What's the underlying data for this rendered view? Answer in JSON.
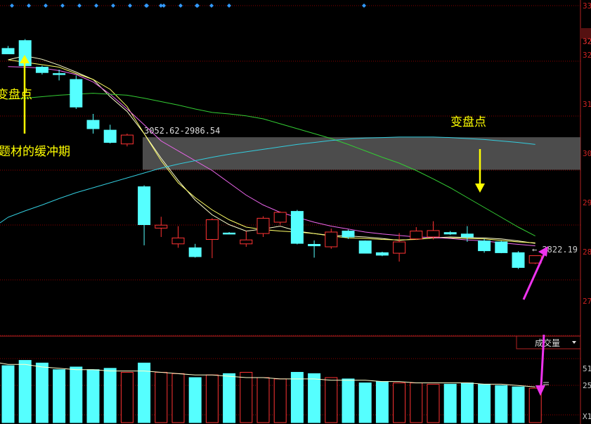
{
  "chart_data": {
    "type": "candlestick",
    "price_axis": {
      "range": [
        2660,
        3320
      ],
      "tick_labels": [
        "33",
        "32",
        "32",
        "31",
        "30",
        "29",
        "28",
        "27"
      ],
      "tick_values": [
        3310,
        3248,
        3220,
        3120,
        3020,
        2920,
        2820,
        2720
      ]
    },
    "volume_axis": {
      "tick_labels": [
        "51",
        "25",
        "X1"
      ],
      "tick_values": [
        51,
        25,
        0
      ]
    },
    "candles": [
      {
        "o": 3233,
        "h": 3238,
        "l": 3222,
        "c": 3222
      },
      {
        "o": 3249,
        "h": 3252,
        "l": 3195,
        "c": 3198
      },
      {
        "o": 3195,
        "h": 3198,
        "l": 3180,
        "c": 3184
      },
      {
        "o": 3182,
        "h": 3190,
        "l": 3168,
        "c": 3180
      },
      {
        "o": 3170,
        "h": 3178,
        "l": 3110,
        "c": 3114
      },
      {
        "o": 3087,
        "h": 3100,
        "l": 3060,
        "c": 3070
      },
      {
        "o": 3067,
        "h": 3078,
        "l": 3040,
        "c": 3042
      },
      {
        "o": 3039,
        "h": 3060,
        "l": 3034,
        "c": 3057
      },
      {
        "o": 2952,
        "h": 2955,
        "l": 2833,
        "c": 2875
      },
      {
        "o": 2868,
        "h": 2891,
        "l": 2850,
        "c": 2874
      },
      {
        "o": 2836,
        "h": 2872,
        "l": 2828,
        "c": 2848
      },
      {
        "o": 2828,
        "h": 2836,
        "l": 2808,
        "c": 2810
      },
      {
        "o": 2845,
        "h": 2888,
        "l": 2807,
        "c": 2885
      },
      {
        "o": 2858,
        "h": 2860,
        "l": 2856,
        "c": 2857
      },
      {
        "o": 2836,
        "h": 2862,
        "l": 2830,
        "c": 2844
      },
      {
        "o": 2857,
        "h": 2892,
        "l": 2850,
        "c": 2888
      },
      {
        "o": 2880,
        "h": 2902,
        "l": 2875,
        "c": 2900
      },
      {
        "o": 2902,
        "h": 2905,
        "l": 2835,
        "c": 2837
      },
      {
        "o": 2835,
        "h": 2843,
        "l": 2808,
        "c": 2832
      },
      {
        "o": 2830,
        "h": 2867,
        "l": 2826,
        "c": 2860
      },
      {
        "o": 2862,
        "h": 2865,
        "l": 2846,
        "c": 2850
      },
      {
        "o": 2842,
        "h": 2843,
        "l": 2817,
        "c": 2817
      },
      {
        "o": 2818,
        "h": 2820,
        "l": 2811,
        "c": 2813
      },
      {
        "o": 2817,
        "h": 2858,
        "l": 2800,
        "c": 2840
      },
      {
        "o": 2846,
        "h": 2870,
        "l": 2844,
        "c": 2862
      },
      {
        "o": 2850,
        "h": 2882,
        "l": 2845,
        "c": 2863
      },
      {
        "o": 2859,
        "h": 2862,
        "l": 2854,
        "c": 2856
      },
      {
        "o": 2856,
        "h": 2872,
        "l": 2840,
        "c": 2850
      },
      {
        "o": 2842,
        "h": 2846,
        "l": 2818,
        "c": 2822
      },
      {
        "o": 2840,
        "h": 2842,
        "l": 2817,
        "c": 2818
      },
      {
        "o": 2818,
        "h": 2821,
        "l": 2785,
        "c": 2788
      },
      {
        "o": 2797,
        "h": 2812,
        "l": 2795,
        "c": 2812
      }
    ],
    "ma_lines": [
      {
        "color": "#ffffcc",
        "values": [
          3210,
          3218,
          3211,
          3199,
          3185,
          3170,
          3135,
          3105,
          3060,
          3010,
          2965,
          2925,
          2895,
          2875,
          2862,
          2866,
          2872,
          2862,
          2857,
          2853,
          2852,
          2850,
          2847,
          2843,
          2846,
          2848,
          2850,
          2849,
          2848,
          2846,
          2842,
          2837
        ]
      },
      {
        "color": "#ffff66",
        "values": [
          3210,
          3205,
          3200,
          3195,
          3182,
          3170,
          3150,
          3115,
          3060,
          3005,
          2960,
          2930,
          2905,
          2885,
          2870,
          2865,
          2862,
          2860,
          2857,
          2852,
          2848,
          2847,
          2845,
          2844,
          2845,
          2848,
          2848,
          2847,
          2846,
          2843,
          2840,
          2838
        ]
      },
      {
        "color": "#ee66ee",
        "values": [
          3196,
          3195,
          3193,
          3188,
          3180,
          3165,
          3140,
          3110,
          3078,
          3045,
          3025,
          3005,
          2985,
          2960,
          2935,
          2915,
          2900,
          2890,
          2880,
          2872,
          2866,
          2860,
          2856,
          2853,
          2850,
          2849,
          2847,
          2844,
          2842,
          2838,
          2835,
          2832
        ]
      },
      {
        "color": "#33cc33",
        "values": [
          3130,
          3132,
          3135,
          3138,
          3140,
          3142,
          3140,
          3138,
          3132,
          3125,
          3118,
          3110,
          3103,
          3100,
          3096,
          3090,
          3080,
          3070,
          3060,
          3050,
          3038,
          3025,
          3012,
          3000,
          2985,
          2968,
          2950,
          2930,
          2910,
          2890,
          2870,
          2852
        ]
      },
      {
        "color": "#33ccdd",
        "values": [
          2890,
          2903,
          2915,
          2928,
          2940,
          2950,
          2960,
          2970,
          2980,
          2990,
          2998,
          3005,
          3012,
          3018,
          3023,
          3028,
          3033,
          3038,
          3042,
          3046,
          3049,
          3051,
          3052,
          3053,
          3053,
          3053,
          3052,
          3050,
          3048,
          3045,
          3042,
          3038
        ]
      }
    ],
    "volume": [
      43,
      47,
      45,
      40,
      42,
      40,
      41,
      38,
      45,
      38,
      37,
      34,
      36,
      37,
      38,
      34,
      33,
      38,
      37,
      34,
      33,
      30,
      31,
      30,
      30,
      29,
      29,
      30,
      29,
      28,
      27,
      26
    ],
    "volume_ma": {
      "color": "#ffffcc",
      "values": [
        44,
        44,
        42,
        41,
        40,
        40,
        39,
        39,
        39,
        38,
        37,
        36,
        36,
        35,
        34,
        34,
        33,
        33,
        33,
        32,
        32,
        32,
        31,
        31,
        30,
        30,
        30,
        30,
        29,
        29,
        28,
        27
      ]
    },
    "band": {
      "from": 2986.54,
      "to": 3052.62,
      "label": "3052.62-2986.54"
    },
    "annotations": [
      {
        "text": "变盘点",
        "color": "#ffff00"
      },
      {
        "text": "题材的缓冲期",
        "color": "#ffff00"
      },
      {
        "text": "变盘点",
        "color": "#ffff00"
      },
      {
        "text": "← 2822.19",
        "color": "#cccccc"
      }
    ],
    "volume_panel_label": "成交量",
    "volume_dropdown_icon": "triangle-down-icon",
    "colors": {
      "up": "#ff3333",
      "down": "#55ffff",
      "grid": "#8b0000",
      "arrow_yellow": "#ffff00",
      "arrow_magenta": "#ee33ee"
    }
  }
}
